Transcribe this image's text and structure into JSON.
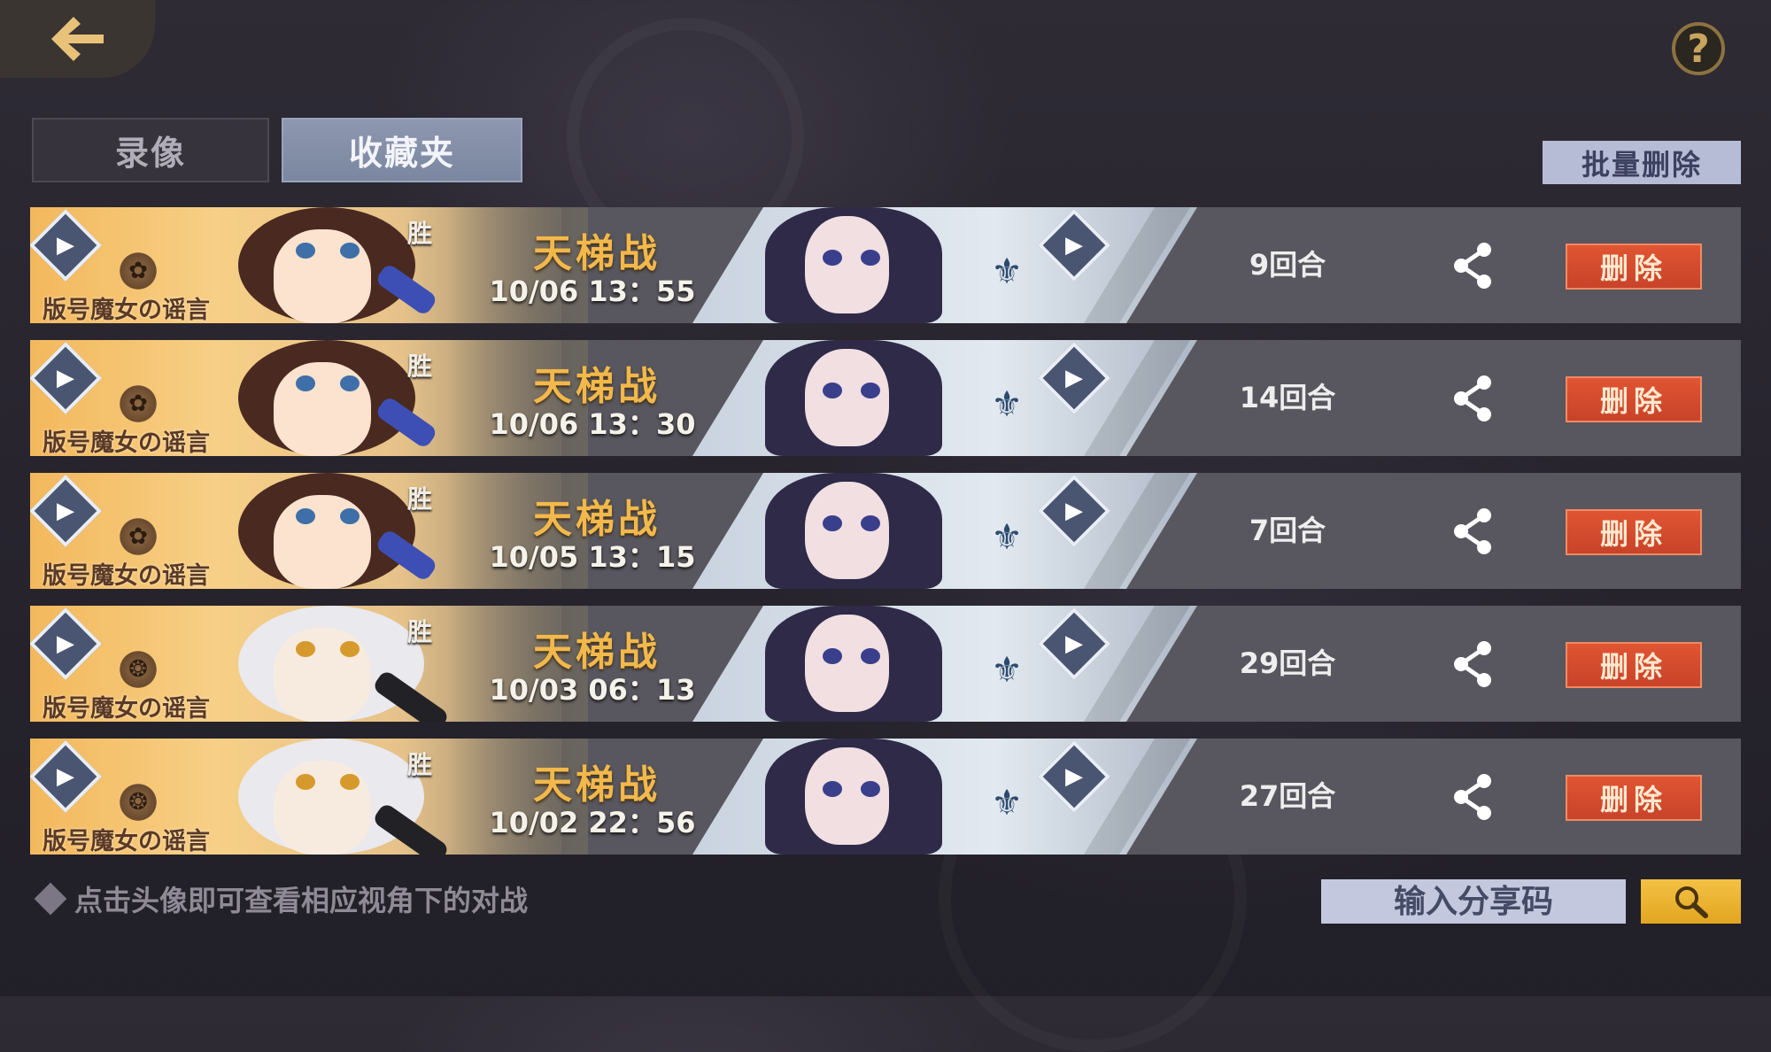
{
  "nav": {
    "back_icon": "back-arrow-icon",
    "help_label": "?"
  },
  "tabs": [
    {
      "label": "录像",
      "active": false
    },
    {
      "label": "收藏夹",
      "active": true
    }
  ],
  "toolbar": {
    "batch_delete_label": "批量删除"
  },
  "records": [
    {
      "player_name": "版号魔女の谣言",
      "result": "胜",
      "mode": "天梯战",
      "time": "10/06 13：55",
      "rounds": "9回合",
      "delete_label": "删除",
      "portrait": "a"
    },
    {
      "player_name": "版号魔女の谣言",
      "result": "胜",
      "mode": "天梯战",
      "time": "10/06 13：30",
      "rounds": "14回合",
      "delete_label": "删除",
      "portrait": "a"
    },
    {
      "player_name": "版号魔女の谣言",
      "result": "胜",
      "mode": "天梯战",
      "time": "10/05 13：15",
      "rounds": "7回合",
      "delete_label": "删除",
      "portrait": "a"
    },
    {
      "player_name": "版号魔女の谣言",
      "result": "胜",
      "mode": "天梯战",
      "time": "10/03 06：13",
      "rounds": "29回合",
      "delete_label": "删除",
      "portrait": "b"
    },
    {
      "player_name": "版号魔女の谣言",
      "result": "胜",
      "mode": "天梯战",
      "time": "10/02 22：56",
      "rounds": "27回合",
      "delete_label": "删除",
      "portrait": "b"
    }
  ],
  "footer": {
    "hint": "点击头像即可查看相应视角下的对战",
    "share_code_placeholder": "输入分享码",
    "search_icon": "search-icon"
  },
  "colors": {
    "accent_gold": "#f2b84b",
    "delete_red": "#d04a2d",
    "tab_active": "#8791aa"
  }
}
